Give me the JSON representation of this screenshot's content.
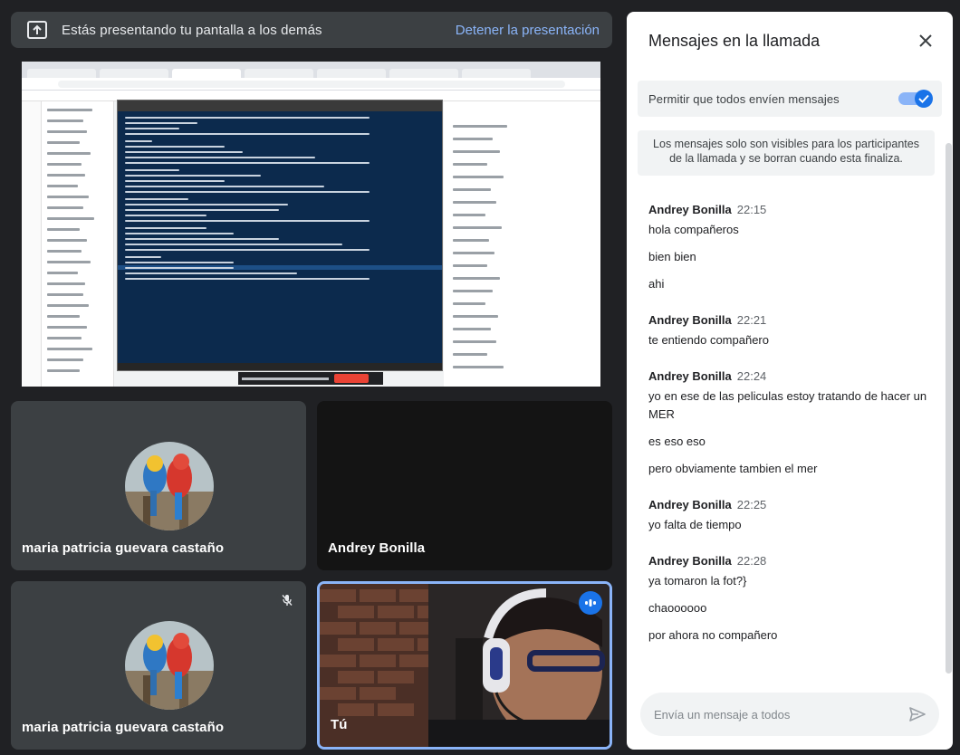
{
  "banner": {
    "text": "Estás presentando tu pantalla a los demás",
    "stop_label": "Detener la presentación"
  },
  "tiles": [
    {
      "name": "maria patricia guevara castaño",
      "state": "camera-off"
    },
    {
      "name": "Andrey Bonilla",
      "state": "video-dark"
    },
    {
      "name": "maria patricia guevara castaño",
      "state": "muted"
    },
    {
      "name": "Tú",
      "state": "self-speaking"
    }
  ],
  "chat": {
    "title": "Mensajes en la llamada",
    "allow_label": "Permitir que todos envíen mensajes",
    "allow_enabled": true,
    "info": "Los mensajes solo son visibles para los participantes de la llamada y se borran cuando esta finaliza.",
    "groups": [
      {
        "author": "Andrey Bonilla",
        "time": "22:15",
        "messages": [
          "hola compañeros",
          "bien bien",
          "ahi"
        ]
      },
      {
        "author": "Andrey Bonilla",
        "time": "22:21",
        "messages": [
          "te entiendo compañero"
        ]
      },
      {
        "author": "Andrey Bonilla",
        "time": "22:24",
        "messages": [
          "yo en ese de las peliculas estoy tratando de hacer un MER",
          "es eso eso",
          "pero obviamente tambien el mer"
        ]
      },
      {
        "author": "Andrey Bonilla",
        "time": "22:25",
        "messages": [
          "yo falta de tiempo"
        ]
      },
      {
        "author": "Andrey Bonilla",
        "time": "22:28",
        "messages": [
          "ya tomaron la fot?}",
          "chaoooooo",
          "por ahora no compañero"
        ]
      }
    ],
    "input_placeholder": "Envía un mensaje a todos"
  },
  "colors": {
    "background": "#202124",
    "surface": "#3c4043",
    "accent": "#8ab4f8",
    "primary": "#1a73e8"
  }
}
